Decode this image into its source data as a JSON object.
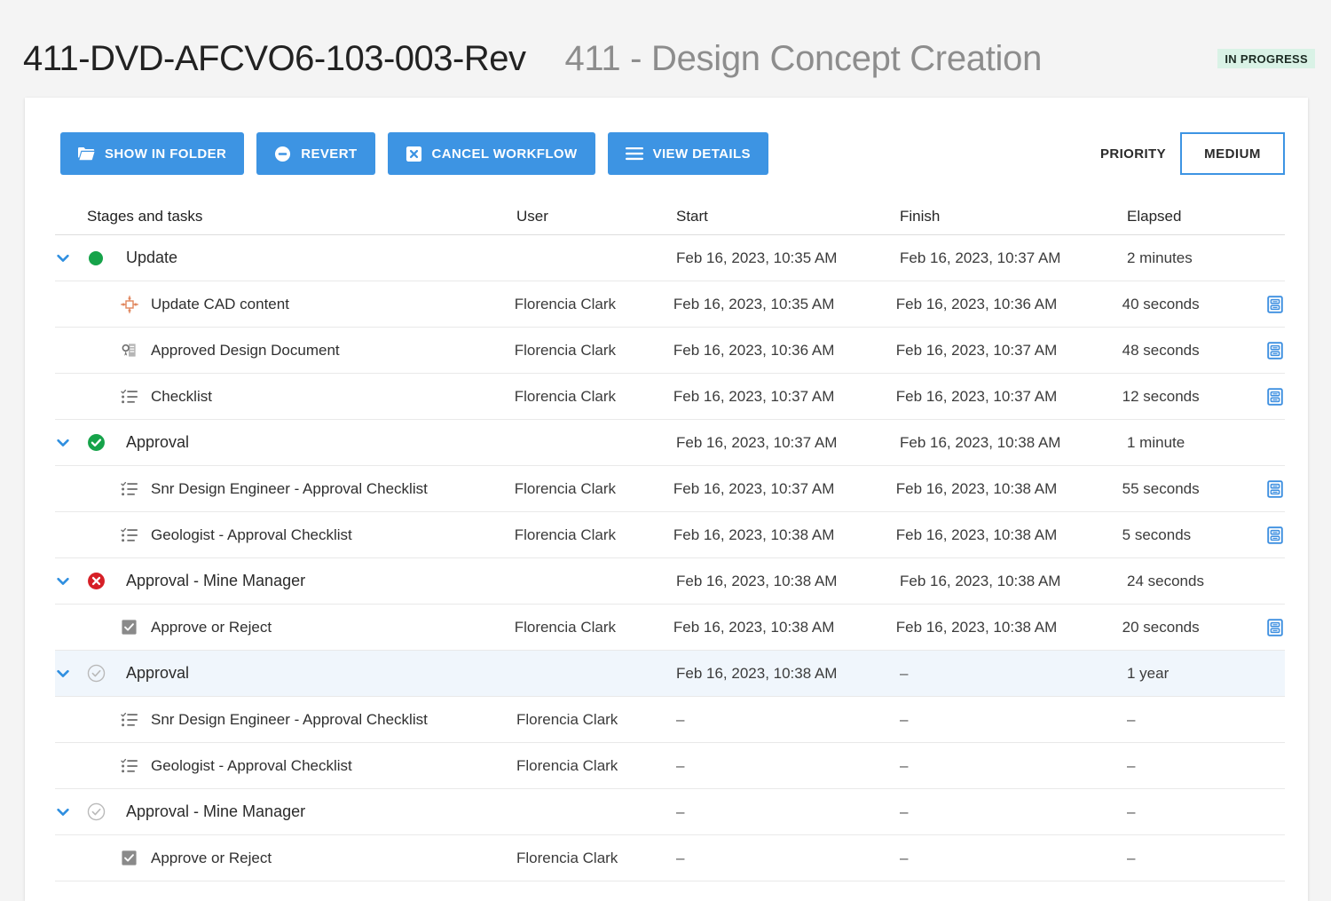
{
  "header": {
    "doc_id": "411-DVD-AFCVO6-103-003-Rev",
    "doc_title": "411 - Design Concept Creation",
    "status_badge": "IN PROGRESS",
    "badge_color": "#d9f2e6"
  },
  "toolbar": {
    "accent_color": "#3d94e3",
    "buttons": [
      {
        "label": "SHOW IN FOLDER",
        "icon": "folder-icon"
      },
      {
        "label": "REVERT",
        "icon": "minus-circle-icon"
      },
      {
        "label": "CANCEL WORKFLOW",
        "icon": "x-square-icon"
      },
      {
        "label": "VIEW DETAILS",
        "icon": "hamburger-icon"
      }
    ],
    "priority_label": "PRIORITY",
    "priority_value": "MEDIUM"
  },
  "table": {
    "columns": {
      "name": "Stages and tasks",
      "user": "User",
      "start": "Start",
      "finish": "Finish",
      "elapsed": "Elapsed"
    },
    "rows": [
      {
        "kind": "stage",
        "expanded": true,
        "status": "in-progress-green-dot",
        "name": "Update",
        "user": "",
        "start": "Feb 16, 2023, 10:35 AM",
        "finish": "Feb 16, 2023, 10:37 AM",
        "elapsed": "2 minutes",
        "action": false,
        "highlight": false
      },
      {
        "kind": "task",
        "icon": "cad-crosshair-icon",
        "name": "Update CAD content",
        "user": "Florencia Clark",
        "start": "Feb 16, 2023, 10:35 AM",
        "finish": "Feb 16, 2023, 10:36 AM",
        "elapsed": "40 seconds",
        "action": true,
        "highlight": false
      },
      {
        "kind": "task",
        "icon": "approved-document-icon",
        "name": "Approved Design Document",
        "user": "Florencia Clark",
        "start": "Feb 16, 2023, 10:36 AM",
        "finish": "Feb 16, 2023, 10:37 AM",
        "elapsed": "48 seconds",
        "action": true,
        "highlight": false
      },
      {
        "kind": "task",
        "icon": "checklist-icon",
        "name": "Checklist",
        "user": "Florencia Clark",
        "start": "Feb 16, 2023, 10:37 AM",
        "finish": "Feb 16, 2023, 10:37 AM",
        "elapsed": "12 seconds",
        "action": true,
        "highlight": false
      },
      {
        "kind": "stage",
        "expanded": true,
        "status": "completed-green-check",
        "name": "Approval",
        "user": "",
        "start": "Feb 16, 2023, 10:37 AM",
        "finish": "Feb 16, 2023, 10:38 AM",
        "elapsed": "1 minute",
        "action": false,
        "highlight": false
      },
      {
        "kind": "task",
        "icon": "checklist-icon",
        "name": "Snr Design Engineer - Approval Checklist",
        "user": "Florencia Clark",
        "start": "Feb 16, 2023, 10:37 AM",
        "finish": "Feb 16, 2023, 10:38 AM",
        "elapsed": "55 seconds",
        "action": true,
        "highlight": false
      },
      {
        "kind": "task",
        "icon": "checklist-icon",
        "name": "Geologist - Approval Checklist",
        "user": "Florencia Clark",
        "start": "Feb 16, 2023, 10:38 AM",
        "finish": "Feb 16, 2023, 10:38 AM",
        "elapsed": "5 seconds",
        "action": true,
        "highlight": false
      },
      {
        "kind": "stage",
        "expanded": true,
        "status": "rejected-red-x",
        "name": "Approval - Mine Manager",
        "user": "",
        "start": "Feb 16, 2023, 10:38 AM",
        "finish": "Feb 16, 2023, 10:38 AM",
        "elapsed": "24 seconds",
        "action": false,
        "highlight": false
      },
      {
        "kind": "task",
        "icon": "checkbox-checked-icon",
        "name": "Approve or Reject",
        "user": "Florencia Clark",
        "start": "Feb 16, 2023, 10:38 AM",
        "finish": "Feb 16, 2023, 10:38 AM",
        "elapsed": "20 seconds",
        "action": true,
        "highlight": false
      },
      {
        "kind": "stage",
        "expanded": true,
        "status": "pending-gray-check",
        "name": "Approval",
        "user": "",
        "start": "Feb 16, 2023, 10:38 AM",
        "finish": "–",
        "elapsed": "1 year",
        "action": false,
        "highlight": true
      },
      {
        "kind": "task",
        "icon": "checklist-icon",
        "name": "Snr Design Engineer - Approval Checklist",
        "user": "Florencia Clark",
        "start": "–",
        "finish": "–",
        "elapsed": "–",
        "action": false,
        "highlight": false
      },
      {
        "kind": "task",
        "icon": "checklist-icon",
        "name": "Geologist - Approval Checklist",
        "user": "Florencia Clark",
        "start": "–",
        "finish": "–",
        "elapsed": "–",
        "action": false,
        "highlight": false
      },
      {
        "kind": "stage",
        "expanded": true,
        "status": "pending-gray-check",
        "name": "Approval - Mine Manager",
        "user": "",
        "start": "–",
        "finish": "–",
        "elapsed": "–",
        "action": false,
        "highlight": false
      },
      {
        "kind": "task",
        "icon": "checkbox-checked-icon",
        "name": "Approve or Reject",
        "user": "Florencia Clark",
        "start": "–",
        "finish": "–",
        "elapsed": "–",
        "action": false,
        "highlight": false
      }
    ]
  }
}
